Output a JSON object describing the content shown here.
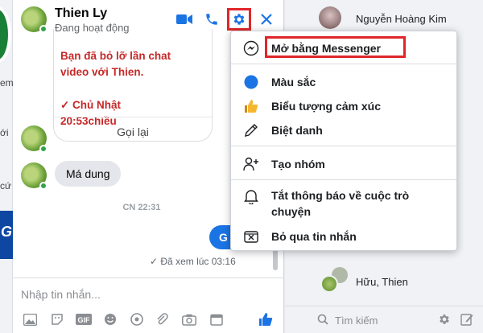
{
  "left_partial": {
    "frag_top": "em",
    "frag_mid": "ới",
    "frag_low": "cứ",
    "promo_letter": "G"
  },
  "chat": {
    "contact_name": "Thien Ly",
    "status": "Đang hoạt động",
    "call_card": {
      "text_top": "Bạn đã bỏ lỡ lần chat\nvideo với Thien.",
      "text_date": "✓ Chủ Nhật\n20:53chiều",
      "callback_label": "Gọi lại"
    },
    "received_message": "Má dung",
    "time_separator": "CN 22:31",
    "sent_message_fragment": "G",
    "seen_text": "✓ Đã xem lúc 03:16",
    "composer_placeholder": "Nhập tin nhắn..."
  },
  "menu": {
    "items": [
      {
        "label": "Mở bằng Messenger",
        "icon": "messenger-icon"
      },
      {
        "label": "Màu sắc",
        "icon": "color-dot-icon"
      },
      {
        "label": "Biểu tượng cảm xúc",
        "icon": "thumbs-up-icon"
      },
      {
        "label": "Biệt danh",
        "icon": "pencil-icon"
      },
      {
        "label": "Tạo nhóm",
        "icon": "add-person-icon"
      },
      {
        "label": "Tắt thông báo về cuộc trò chuyện",
        "icon": "bell-icon"
      },
      {
        "label": "Bỏ qua tin nhắn",
        "icon": "ignore-icon"
      }
    ]
  },
  "contacts": {
    "top_contact": "Nguyễn Hoàng Kim",
    "group_contact": "Hữu, Thien",
    "search_placeholder": "Tìm kiếm"
  },
  "colors": {
    "accent": "#1b74e4",
    "highlight_box": "#e0262a",
    "missed_call_text": "#c62828",
    "online": "#31a24c"
  }
}
